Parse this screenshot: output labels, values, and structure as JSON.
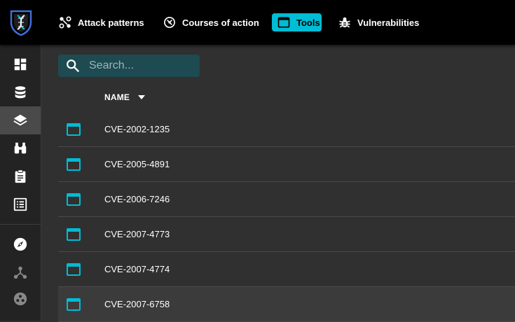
{
  "header": {
    "nav": [
      {
        "label": "Attack patterns",
        "icon": "attack-pattern-icon",
        "active": false
      },
      {
        "label": "Courses of action",
        "icon": "course-of-action-icon",
        "active": false
      },
      {
        "label": "Tools",
        "icon": "tool-window-icon",
        "active": true
      },
      {
        "label": "Vulnerabilities",
        "icon": "bug-icon",
        "active": false
      }
    ]
  },
  "sidebar": {
    "items": [
      {
        "icon": "dashboard-icon",
        "active": false
      },
      {
        "icon": "database-icon",
        "active": false
      },
      {
        "icon": "layers-icon",
        "active": true
      },
      {
        "icon": "binoculars-icon",
        "active": false
      },
      {
        "icon": "clipboard-icon",
        "active": false
      },
      {
        "icon": "list-icon",
        "active": false
      },
      {
        "icon": "compass-icon",
        "active": false
      },
      {
        "icon": "network-icon",
        "active": false
      },
      {
        "icon": "dots-circle-icon",
        "active": false
      }
    ]
  },
  "search": {
    "placeholder": "Search..."
  },
  "table": {
    "columns": [
      {
        "label": "NAME",
        "sort": "descending"
      }
    ],
    "rows": [
      {
        "name": "CVE-2002-1235"
      },
      {
        "name": "CVE-2005-4891"
      },
      {
        "name": "CVE-2006-7246"
      },
      {
        "name": "CVE-2007-4773"
      },
      {
        "name": "CVE-2007-4774"
      },
      {
        "name": "CVE-2007-6758"
      }
    ]
  },
  "colors": {
    "accent": "#00bcd4",
    "topbar": "#000000",
    "sidebar": "#232323",
    "background": "#303030",
    "search_bg": "#1e4a52"
  }
}
